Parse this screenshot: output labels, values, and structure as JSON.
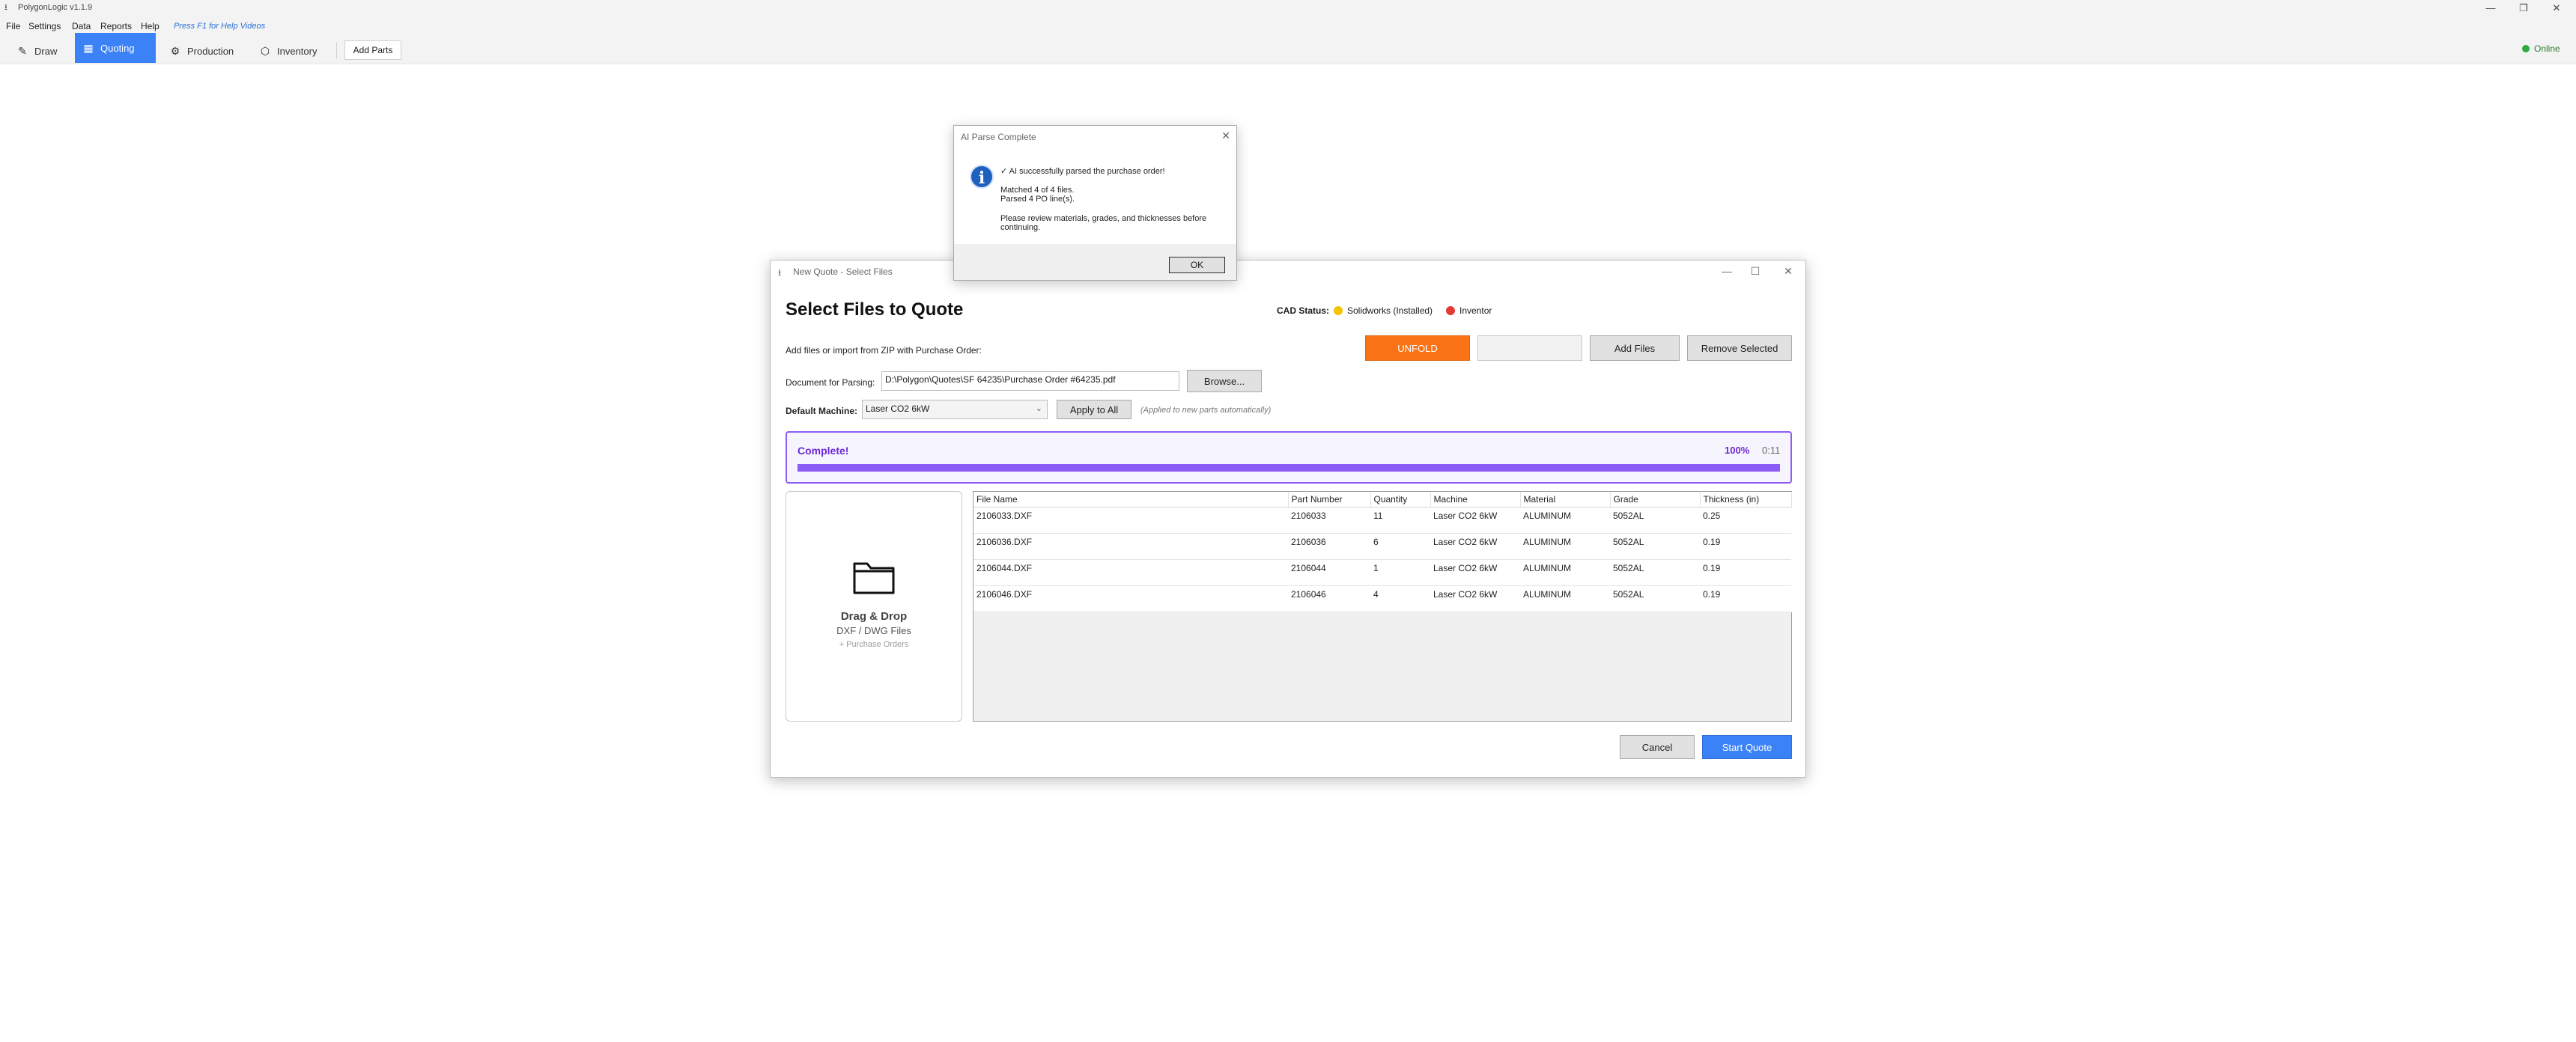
{
  "app": {
    "title": "PolygonLogic v1.1.9",
    "window_controls": {
      "minimize": "—",
      "maximize": "❐",
      "close": "✕"
    }
  },
  "menu": {
    "items": [
      "File",
      "Settings",
      "Data",
      "Reports",
      "Help"
    ],
    "hint": "Press F1 for Help Videos"
  },
  "toolbar": {
    "tabs": [
      {
        "label": "Draw",
        "icon": "pencil-icon",
        "active": false
      },
      {
        "label": "Quoting",
        "icon": "calculator-icon",
        "active": true
      },
      {
        "label": "Production",
        "icon": "gear-icon",
        "active": false
      },
      {
        "label": "Inventory",
        "icon": "box-icon",
        "active": false
      }
    ],
    "add_parts": "Add Parts",
    "status": "Online",
    "status_color": "#2eaa3f"
  },
  "quote_dialog": {
    "title": "New Quote - Select Files",
    "heading": "Select Files to Quote",
    "cad_status_label": "CAD Status:",
    "cad_items": [
      {
        "name": "Solidworks (Installed)",
        "color": "#f5c400"
      },
      {
        "name": "Inventor",
        "color": "#e53935"
      }
    ],
    "add_files_label": "Add files or import from ZIP with Purchase Order:",
    "buttons": {
      "unfold": "UNFOLD",
      "blank": "",
      "add_files": "Add Files",
      "remove_selected": "Remove Selected",
      "browse": "Browse...",
      "apply_all": "Apply to All",
      "cancel": "Cancel",
      "start_quote": "Start Quote"
    },
    "document_label": "Document for Parsing:",
    "document_path": "D:\\Polygon\\Quotes\\SF 64235\\Purchase Order #64235.pdf",
    "default_machine_label": "Default Machine:",
    "default_machine_value": "Laser CO2 6kW",
    "machine_hint": "(Applied to new parts automatically)",
    "progress": {
      "status": "Complete!",
      "percent_label": "100%",
      "percent": 100,
      "elapsed": "0:11"
    },
    "dropzone": {
      "title": "Drag & Drop",
      "subtitle": "DXF / DWG Files",
      "extra": "+ Purchase Orders"
    },
    "table": {
      "columns": [
        "File Name",
        "Part Number",
        "Quantity",
        "Machine",
        "Material",
        "Grade",
        "Thickness (in)"
      ],
      "rows": [
        [
          "2106033.DXF",
          "2106033",
          "11",
          "Laser CO2 6kW",
          "ALUMINUM",
          "5052AL",
          "0.25"
        ],
        [
          "2106036.DXF",
          "2106036",
          "6",
          "Laser CO2 6kW",
          "ALUMINUM",
          "5052AL",
          "0.19"
        ],
        [
          "2106044.DXF",
          "2106044",
          "1",
          "Laser CO2 6kW",
          "ALUMINUM",
          "5052AL",
          "0.19"
        ],
        [
          "2106046.DXF",
          "2106046",
          "4",
          "Laser CO2 6kW",
          "ALUMINUM",
          "5052AL",
          "0.19"
        ]
      ]
    }
  },
  "parse_dialog": {
    "title": "AI Parse Complete",
    "lines": [
      "✓ AI successfully parsed the purchase order!",
      "Matched 4 of 4 files.",
      "Parsed 4 PO line(s).",
      "Please review materials, grades, and thicknesses before",
      "continuing."
    ],
    "ok": "OK"
  }
}
